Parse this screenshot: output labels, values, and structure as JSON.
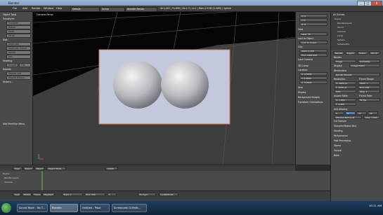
{
  "window": {
    "title": "Blender",
    "minimize": "_",
    "maximize": "□",
    "close": "X"
  },
  "menu": {
    "items": [
      "File",
      "Add",
      "Render",
      "Window",
      "Help"
    ],
    "layout": "Default",
    "scene": "Scene",
    "engine": "Blender Render",
    "stats": "Ve:1,002 | Fa:896 | Ob:1-3 | La:1 | Mem:10.5M (0.00M) | Sphere"
  },
  "tool_shelf": {
    "object_tools": "Object Tools",
    "transform": "Transform:",
    "transform_buttons": [
      "Translate",
      "Rotate",
      "Scale",
      "Mirror"
    ],
    "edit": "Edit:",
    "edit_buttons": [
      "Duplicate",
      "Duplicate Linked",
      "Delete",
      "Join"
    ],
    "shading": "Shading:",
    "smooth": "Smooth",
    "flat": "Flat",
    "repeat": "Repeat:",
    "repeat_buttons": [
      "Repeat Last",
      "Repeat History..."
    ],
    "history": "History...",
    "footer": "Add Primitive Menu"
  },
  "viewport": {
    "label": "Camera Persp"
  },
  "n_panel": {
    "coords": [
      "X: 0.",
      "Y: 0.",
      "Z: 0."
    ],
    "view": "View",
    "lens": "Lens: 35",
    "lock": "Lock to Object",
    "lock_cursor": "Lock to Cursor",
    "clip": "Clip:",
    "start": "Start: 0.100",
    "end": "End: 1000.000",
    "local_camera": "Local Camera",
    "cursor3d": "3D Cursor",
    "location": "Location:",
    "cursor_coords": [
      "X: 0.0000",
      "Y: 0.0000",
      "Z: 0.0000"
    ],
    "item": "Item",
    "display": "Display",
    "bg_images": "Background Images",
    "transform_orient": "Transform Orientations"
  },
  "outliner": {
    "header": "All Scenes",
    "rows": [
      "Scene",
      "RenderLayers",
      "World",
      "Camera",
      "Lamp",
      "Sphere",
      "Sphere.001"
    ]
  },
  "properties": {
    "tabs": [
      "Render",
      "Layers",
      "Scene",
      "World"
    ],
    "render_label": "Render",
    "render_btn": "Image",
    "anim_btn": "Animation",
    "display": "Display:",
    "display_value": "Image Editor",
    "dimensions": "Dimensions",
    "preset": "Render Presets",
    "resolution": "Resolution:",
    "res_x": "X: 1920 px",
    "res_y": "Y: 1080 px",
    "res_pct": "50%",
    "frame_range": "Frame Range:",
    "start_frame": "Start: 1",
    "end_frame": "End: 250",
    "step": "Step: 1",
    "aspect": "Aspect Ratio:",
    "ax": "X: 1.000",
    "ay": "Y: 1.000",
    "frame_rate": "Frame Rate:",
    "fps": "30 fps",
    "anti_alias": "Anti-Aliasing",
    "sampled": "Sampled Motion Blur",
    "shading": "Shading",
    "performance": "Performance",
    "post_processing": "Post Processing",
    "stamp": "Stamp",
    "output": "Output",
    "bake": "Bake",
    "aa_samples": [
      "5",
      "8",
      "11",
      "16"
    ],
    "filter": "Mitchell-Netravali",
    "full_sample": "Full Sample",
    "size": "Size: 1.000"
  },
  "viewport_header": {
    "buttons": [
      "View",
      "Select",
      "Object",
      "Object Mode",
      "Global"
    ]
  },
  "timeline_header": {
    "buttons": [
      "View",
      "Marker",
      "Frame",
      "Playback"
    ],
    "start": "Start: 1",
    "end": "End: 250",
    "frame": "1",
    "sync": "No Sync",
    "keying": "LocRotScale"
  },
  "timeline_tracks": [
    "Scene",
    "RenderLayers",
    "Camera"
  ],
  "taskbar": {
    "tasks": [
      "Sound Mixer - No T...",
      "Blender",
      "Untitled - Paint",
      "Screencast-O-Matic..."
    ],
    "clock": "10:11 AM"
  }
}
